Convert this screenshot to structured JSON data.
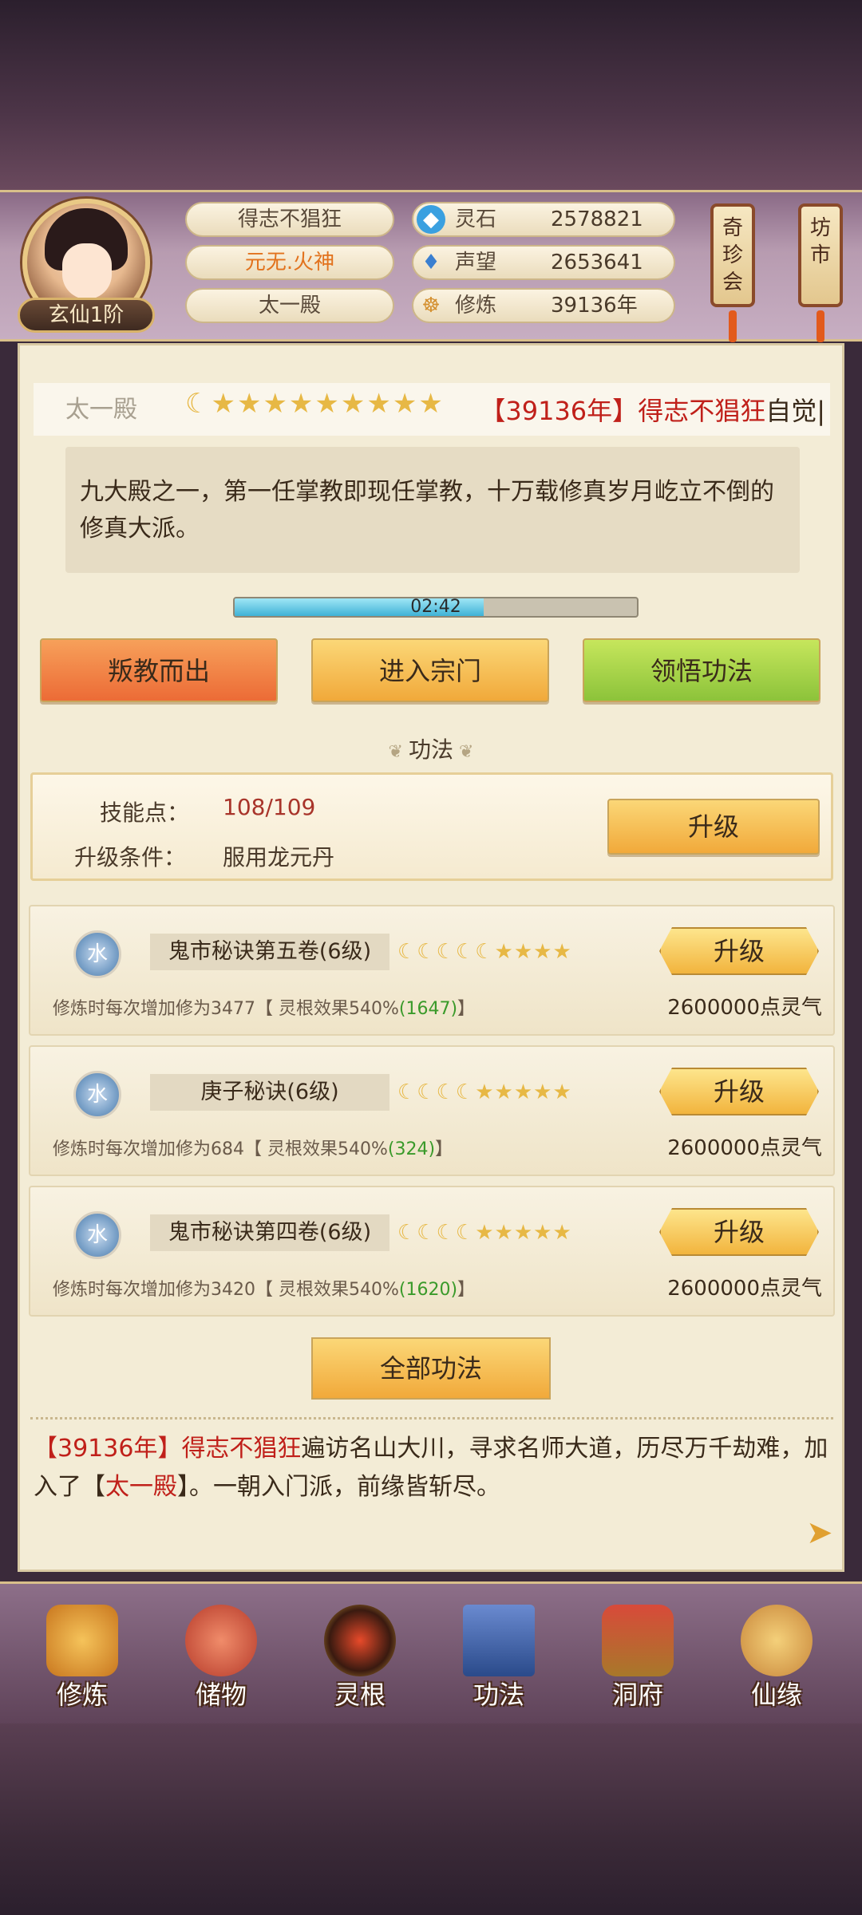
{
  "header": {
    "rank": "玄仙1阶",
    "names": [
      "得志不猖狂",
      "元无.火神",
      "太一殿"
    ],
    "stats": [
      {
        "icon": "spirit-stone-icon",
        "label": "灵石",
        "value": "2578821"
      },
      {
        "icon": "reputation-icon",
        "label": "声望",
        "value": "2653641"
      },
      {
        "icon": "cultivation-icon",
        "label": "修炼",
        "value": "39136年"
      }
    ],
    "banners": [
      "奇珍会",
      "坊市"
    ]
  },
  "ticker": {
    "left": "太一殿",
    "stars": "☾★★★★★★★★★",
    "right_open": "【",
    "right_year": "39136年",
    "right_mid": "】",
    "right_name": "得志不猖狂",
    "right_tail": "自觉",
    "right_end": "|"
  },
  "sect": {
    "description": "九大殿之一，第一任掌教即现任掌教，十万载修真岁月屹立不倒的修真大派。",
    "timer": "02:42",
    "progress": 0.62
  },
  "actions": {
    "leave": "叛教而出",
    "enter": "进入宗门",
    "comprehend": "领悟功法"
  },
  "section_title": "功法",
  "skill": {
    "points_label": "技能点：",
    "points_value": "108/109",
    "condition_label": "升级条件：",
    "condition_value": "服用龙元丹",
    "upgrade": "升级"
  },
  "techniques": [
    {
      "element": "水",
      "name": "鬼市秘诀第五卷(6级)",
      "stars": "☾☾☾☾☾★★★★",
      "upgrade": "升级",
      "desc_main": "修炼时每次增加修为3477【 灵根效果540%",
      "desc_bonus": "(1647)",
      "desc_end": "】",
      "cost": "2600000点灵气"
    },
    {
      "element": "水",
      "name": "庚子秘诀(6级)",
      "stars": "☾☾☾☾★★★★★",
      "upgrade": "升级",
      "desc_main": "修炼时每次增加修为684【 灵根效果540%",
      "desc_bonus": "(324)",
      "desc_end": "】",
      "cost": "2600000点灵气"
    },
    {
      "element": "水",
      "name": "鬼市秘诀第四卷(6级)",
      "stars": "☾☾☾☾★★★★★",
      "upgrade": "升级",
      "desc_main": "修炼时每次增加修为3420【 灵根效果540%",
      "desc_bonus": "(1620)",
      "desc_end": "】",
      "cost": "2600000点灵气"
    }
  ],
  "all_techniques": "全部功法",
  "log": {
    "open": "【",
    "year": "39136年",
    "mid": "】",
    "name": "得志不猖狂",
    "text1": "遍访名山大川，寻求名师大道，历尽万千劫难，加入了",
    "open2": "【",
    "sect": "太一殿",
    "close2": "】",
    "text2": "。一朝入门派，前缘皆斩尽。"
  },
  "nav": [
    {
      "label": "修炼",
      "icon": "meditation-icon"
    },
    {
      "label": "储物",
      "icon": "bag-icon"
    },
    {
      "label": "灵根",
      "icon": "spirit-root-icon"
    },
    {
      "label": "功法",
      "icon": "book-icon"
    },
    {
      "label": "洞府",
      "icon": "cave-house-icon"
    },
    {
      "label": "仙缘",
      "icon": "gourd-icon"
    }
  ]
}
